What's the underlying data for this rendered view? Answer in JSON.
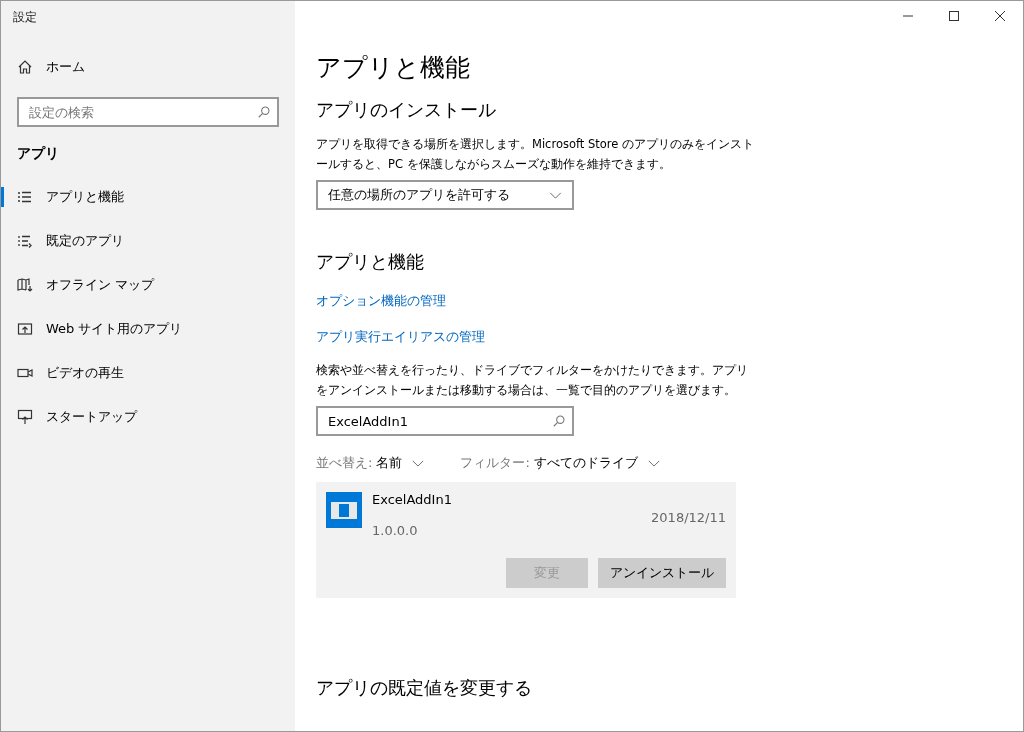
{
  "window": {
    "title": "設定"
  },
  "sidebar": {
    "home": "ホーム",
    "search": {
      "placeholder": "設定の検索"
    },
    "section": "アプリ",
    "items": [
      {
        "label": "アプリと機能",
        "selected": true
      },
      {
        "label": "既定のアプリ",
        "selected": false
      },
      {
        "label": "オフライン マップ",
        "selected": false
      },
      {
        "label": "Web サイト用のアプリ",
        "selected": false
      },
      {
        "label": "ビデオの再生",
        "selected": false
      },
      {
        "label": "スタートアップ",
        "selected": false
      }
    ]
  },
  "main": {
    "title": "アプリと機能",
    "install": {
      "heading": "アプリのインストール",
      "description": "アプリを取得できる場所を選択します。Microsoft Store のアプリのみをインストールすると、PC を保護しながらスムーズな動作を維持できます。",
      "dropdown": "任意の場所のアプリを許可する"
    },
    "apps": {
      "heading": "アプリと機能",
      "links": [
        "オプション機能の管理",
        "アプリ実行エイリアスの管理"
      ],
      "description": "検索や並べ替えを行ったり、ドライブでフィルターをかけたりできます。アプリをアンインストールまたは移動する場合は、一覧で目的のアプリを選びます。",
      "search": {
        "value": "ExcelAddIn1"
      },
      "sort": {
        "label": "並べ替え:",
        "value": "名前"
      },
      "filter": {
        "label": "フィルター:",
        "value": "すべてのドライブ"
      },
      "list": [
        {
          "name": "ExcelAddIn1",
          "version": "1.0.0.0",
          "date": "2018/12/11",
          "selected": true,
          "buttons": [
            {
              "label": "変更",
              "disabled": true
            },
            {
              "label": "アンインストール",
              "disabled": false
            }
          ]
        }
      ]
    },
    "next_heading": "アプリの既定値を変更する"
  }
}
